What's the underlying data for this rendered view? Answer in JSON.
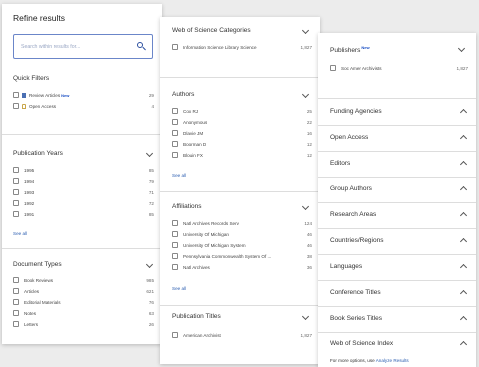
{
  "refine": {
    "title": "Refine results",
    "search_placeholder": "Search within results for...",
    "quick_filters": {
      "title": "Quick Filters",
      "items": [
        {
          "label": "Review Articles",
          "badge": "New",
          "count": "29"
        },
        {
          "label": "Open Access",
          "count": "4"
        }
      ]
    },
    "publication_years": {
      "title": "Publication Years",
      "items": [
        {
          "label": "1995",
          "count": "85"
        },
        {
          "label": "1994",
          "count": "79"
        },
        {
          "label": "1993",
          "count": "71"
        },
        {
          "label": "1992",
          "count": "72"
        },
        {
          "label": "1991",
          "count": "85"
        }
      ],
      "see_all": "See all"
    },
    "document_types": {
      "title": "Document Types",
      "items": [
        {
          "label": "Book Reviews",
          "count": "985"
        },
        {
          "label": "Articles",
          "count": "621"
        },
        {
          "label": "Editorial Materials",
          "count": "76"
        },
        {
          "label": "Notes",
          "count": "63"
        },
        {
          "label": "Letters",
          "count": "26"
        }
      ]
    }
  },
  "middle": {
    "wos_categories": {
      "title": "Web of Science Categories",
      "items": [
        {
          "label": "Information Science Library Science",
          "count": "1,827"
        }
      ]
    },
    "authors": {
      "title": "Authors",
      "items": [
        {
          "label": "Cox RJ",
          "count": "25"
        },
        {
          "label": "Anonymous",
          "count": "22"
        },
        {
          "label": "Dlavie JM",
          "count": "16"
        },
        {
          "label": "Boorman D",
          "count": "12"
        },
        {
          "label": "Blouin FX",
          "count": "12"
        }
      ],
      "see_all": "See all"
    },
    "affiliations": {
      "title": "Affiliations",
      "items": [
        {
          "label": "Natl Archives Records Serv",
          "count": "124"
        },
        {
          "label": "University Of Michigan",
          "count": "46"
        },
        {
          "label": "University Of Michigan System",
          "count": "46"
        },
        {
          "label": "Pennsylvania Commonwealth System Of ...",
          "count": "38"
        },
        {
          "label": "Natl Archives",
          "count": "36"
        }
      ],
      "see_all": "See all"
    },
    "publication_titles": {
      "title": "Publication Titles",
      "items": [
        {
          "label": "American Archivist",
          "count": "1,827"
        }
      ]
    }
  },
  "right": {
    "publishers": {
      "title": "Publishers",
      "badge": "New",
      "items": [
        {
          "label": "Soc Amer Archivists",
          "count": "1,827"
        }
      ]
    },
    "collapsed": [
      "Funding Agencies",
      "Open Access",
      "Editors",
      "Group Authors",
      "Research Areas",
      "Countries/Regions",
      "Languages",
      "Conference Titles",
      "Book Series Titles",
      "Web of Science Index"
    ],
    "footer_prefix": "For more options, use",
    "footer_link": "Analyze Results"
  },
  "colors": {
    "link": "#2a5db0",
    "new_badge": "#1a4fc4",
    "search_border": "#6b86c9"
  }
}
